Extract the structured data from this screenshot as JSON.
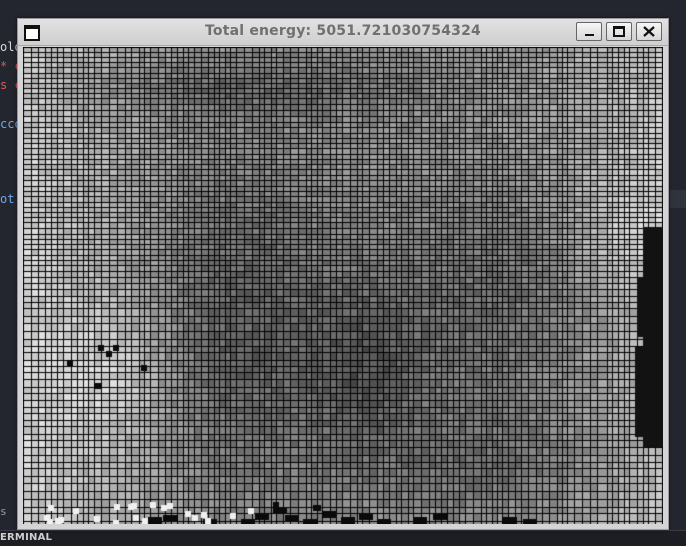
{
  "window": {
    "title": "Total energy: 5051.721030754324"
  },
  "background_editor": {
    "lines": [
      "olo",
      "* c",
      "s c",
      "cco",
      "ot:"
    ],
    "side_text": "s"
  },
  "panel": {
    "label": "ERMINAL"
  },
  "icons": {
    "app": "window-app-icon",
    "minimize": "minimize-icon",
    "maximize": "maximize-icon",
    "close": "close-icon"
  },
  "colors": {
    "background": "#23262e",
    "titlebar": "#d4d4d4",
    "title_text": "#707070"
  }
}
